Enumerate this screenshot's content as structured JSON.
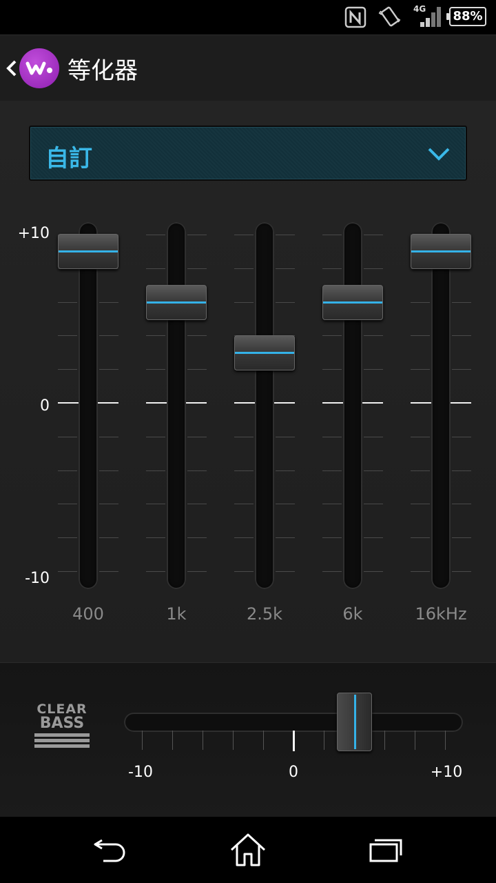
{
  "status": {
    "network": "4G",
    "battery": "88%"
  },
  "header": {
    "title": "等化器"
  },
  "preset": {
    "label": "自訂"
  },
  "equalizer": {
    "scale_top": "+10",
    "scale_mid": "0",
    "scale_bottom": "-10",
    "range": [
      -10,
      10
    ],
    "bands": [
      {
        "freq": "400",
        "value": 9
      },
      {
        "freq": "1k",
        "value": 6
      },
      {
        "freq": "2.5k",
        "value": 3
      },
      {
        "freq": "6k",
        "value": 6
      },
      {
        "freq": "16kHz",
        "value": 9
      }
    ]
  },
  "clear_bass": {
    "logo_line1": "CLEAR",
    "logo_line2": "BASS",
    "min_label": "-10",
    "mid_label": "0",
    "max_label": "+10",
    "value": 4
  },
  "colors": {
    "accent": "#34b2e8",
    "logo": "#a632c8"
  }
}
